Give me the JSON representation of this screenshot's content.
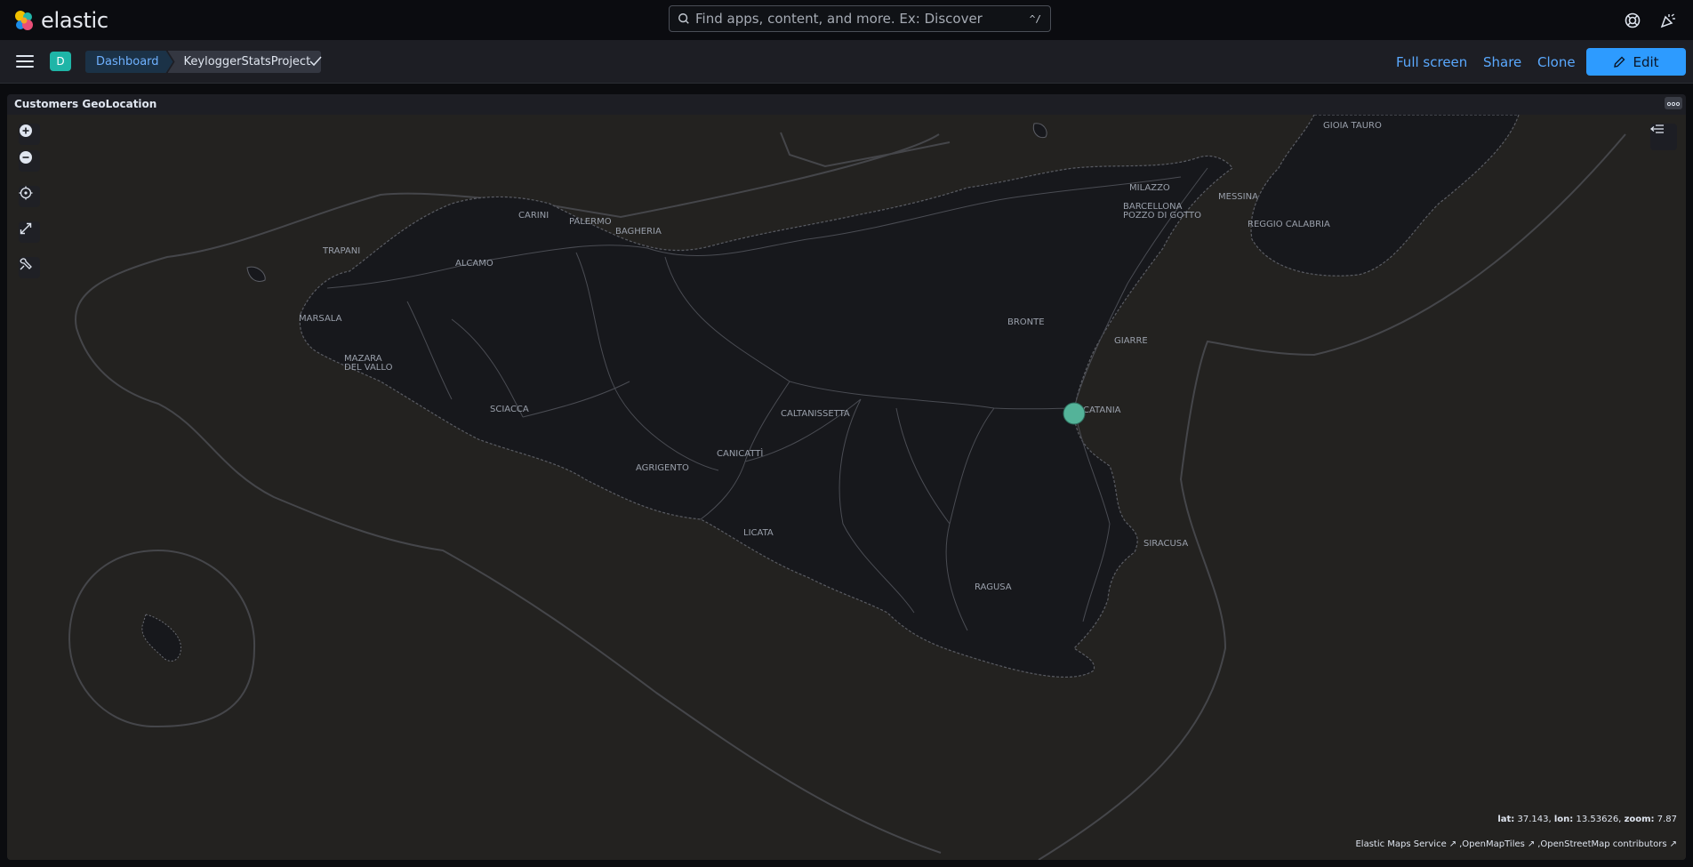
{
  "header": {
    "brand": "elastic",
    "search_placeholder": "Find apps, content, and more. Ex: Discover",
    "search_shortcut": "^/"
  },
  "nav": {
    "space_initial": "D",
    "breadcrumbs": [
      "Dashboard",
      "KeyloggerStatsProject"
    ],
    "actions": {
      "full_screen": "Full screen",
      "share": "Share",
      "clone": "Clone",
      "edit": "Edit"
    }
  },
  "panel": {
    "title": "Customers GeoLocation",
    "map": {
      "cities": [
        "GIOIA TAURO",
        "MILAZZO",
        "MESSINA",
        "BARCELLONA",
        "POZZO DI GOTTO",
        "REGGIO CALABRIA",
        "CARINI",
        "PALERMO",
        "BAGHERIA",
        "TRAPANI",
        "ALCAMO",
        "MARSALA",
        "BRONTE",
        "GIARRE",
        "MAZARA",
        "DEL VALLO",
        "SCIACCA",
        "CATANIA",
        "CALTANISSETTA",
        "CANICATTÌ",
        "AGRIGENTO",
        "LICATA",
        "SIRACUSA",
        "RAGUSA"
      ],
      "coords": {
        "lat_label": "lat:",
        "lat": "37.143,",
        "lon_label": "lon:",
        "lon": "13.53626,",
        "zoom_label": "zoom:",
        "zoom": "7.87"
      },
      "attribution": [
        "Elastic Maps Service",
        ",OpenMapTiles",
        ",OpenStreetMap contributors"
      ],
      "marker_color": "#54b399"
    }
  },
  "colors": {
    "accent": "#2d9bff",
    "link": "#5aa9ff",
    "map_background": "#232220",
    "land": "#17181c"
  }
}
